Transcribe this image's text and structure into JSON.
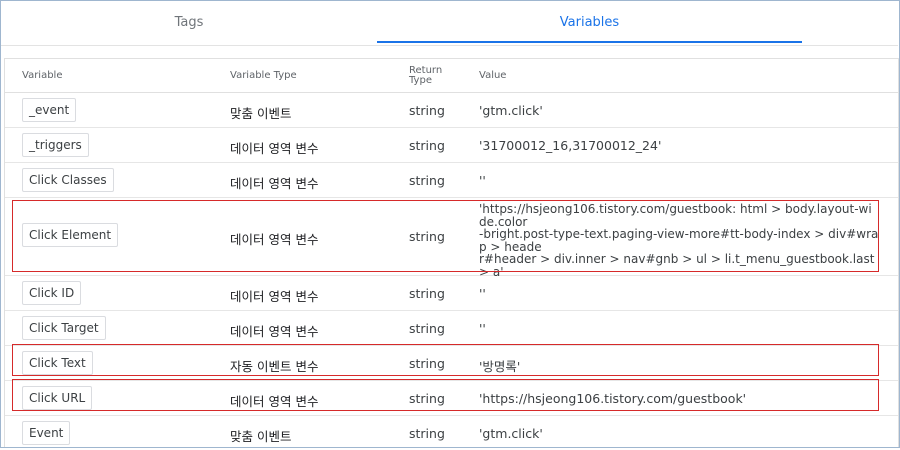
{
  "tabs": {
    "tags": "Tags",
    "variables": "Variables"
  },
  "columns": {
    "variable": "Variable",
    "type": "Variable Type",
    "return_type": "Return Type",
    "value": "Value"
  },
  "rows": [
    {
      "name": "_event",
      "type": "맞춤 이벤트",
      "return": "string",
      "value": "'gtm.click'"
    },
    {
      "name": "_triggers",
      "type": "데이터 영역 변수",
      "return": "string",
      "value": "'31700012_16,31700012_24'"
    },
    {
      "name": "Click Classes",
      "type": "데이터 영역 변수",
      "return": "string",
      "value": "''"
    },
    {
      "name": "Click Element",
      "type": "데이터 영역 변수",
      "return": "string",
      "value_lines": [
        "'https://hsjeong106.tistory.com/guestbook: html > body.layout-wide.color",
        "-bright.post-type-text.paging-view-more#tt-body-index > div#wrap > heade",
        "r#header > div.inner > nav#gnb > ul > li.t_menu_guestbook.last > a'"
      ]
    },
    {
      "name": "Click ID",
      "type": "데이터 영역 변수",
      "return": "string",
      "value": "''"
    },
    {
      "name": "Click Target",
      "type": "데이터 영역 변수",
      "return": "string",
      "value": "''"
    },
    {
      "name": "Click Text",
      "type": "자동 이벤트 변수",
      "return": "string",
      "value": "'방명록'"
    },
    {
      "name": "Click URL",
      "type": "데이터 영역 변수",
      "return": "string",
      "value": "'https://hsjeong106.tistory.com/guestbook'"
    },
    {
      "name": "Event",
      "type": "맞춤 이벤트",
      "return": "string",
      "value": "'gtm.click'"
    }
  ],
  "highlight_color": "#d62a2a",
  "accent_color": "#1a73e8"
}
